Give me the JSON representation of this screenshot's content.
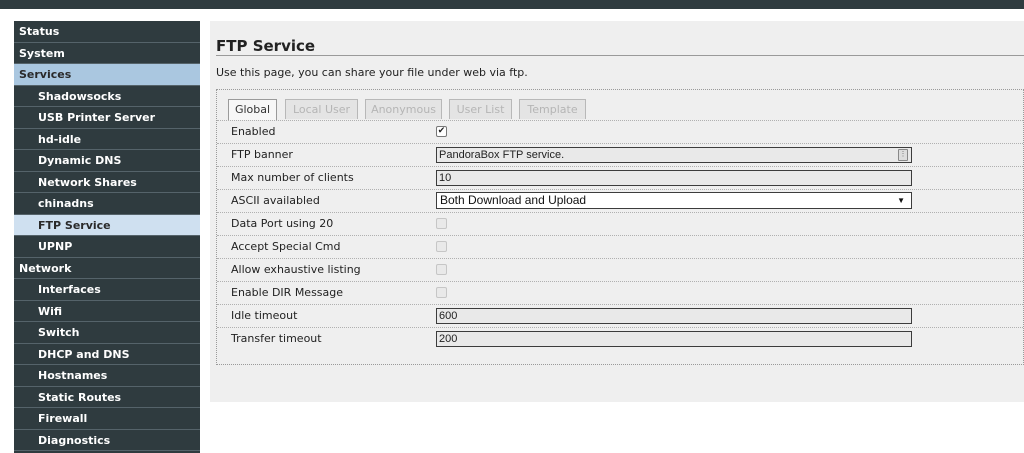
{
  "sidebar": {
    "items": [
      {
        "label": "Status",
        "level": "section",
        "state": ""
      },
      {
        "label": "System",
        "level": "section",
        "state": ""
      },
      {
        "label": "Services",
        "level": "section",
        "state": "active"
      },
      {
        "label": "Shadowsocks",
        "level": "sub",
        "state": ""
      },
      {
        "label": "USB Printer Server",
        "level": "sub",
        "state": ""
      },
      {
        "label": "hd-idle",
        "level": "sub",
        "state": ""
      },
      {
        "label": "Dynamic DNS",
        "level": "sub",
        "state": ""
      },
      {
        "label": "Network Shares",
        "level": "sub",
        "state": ""
      },
      {
        "label": "chinadns",
        "level": "sub",
        "state": ""
      },
      {
        "label": "FTP Service",
        "level": "sub",
        "state": "active"
      },
      {
        "label": "UPNP",
        "level": "sub",
        "state": ""
      },
      {
        "label": "Network",
        "level": "section",
        "state": ""
      },
      {
        "label": "Interfaces",
        "level": "sub",
        "state": ""
      },
      {
        "label": "Wifi",
        "level": "sub",
        "state": ""
      },
      {
        "label": "Switch",
        "level": "sub",
        "state": ""
      },
      {
        "label": "DHCP and DNS",
        "level": "sub",
        "state": ""
      },
      {
        "label": "Hostnames",
        "level": "sub",
        "state": ""
      },
      {
        "label": "Static Routes",
        "level": "sub",
        "state": ""
      },
      {
        "label": "Firewall",
        "level": "sub",
        "state": ""
      },
      {
        "label": "Diagnostics",
        "level": "sub",
        "state": ""
      }
    ]
  },
  "page": {
    "title": "FTP Service",
    "description": "Use this page, you can share your file under web via ftp."
  },
  "tabs": [
    {
      "label": "Global",
      "active": true
    },
    {
      "label": "Local User",
      "active": false
    },
    {
      "label": "Anonymous",
      "active": false
    },
    {
      "label": "User List",
      "active": false
    },
    {
      "label": "Template",
      "active": false
    }
  ],
  "form": {
    "enabled": {
      "label": "Enabled",
      "checked": true
    },
    "ftp_banner": {
      "label": "FTP banner",
      "value": "PandoraBox FTP service."
    },
    "max_clients": {
      "label": "Max number of clients",
      "value": "10"
    },
    "ascii": {
      "label": "ASCII availabled",
      "value": "Both Download and Upload"
    },
    "data_port": {
      "label": "Data Port using 20",
      "checked": false
    },
    "special_cmd": {
      "label": "Accept Special Cmd",
      "checked": false
    },
    "exhaustive_listing": {
      "label": "Allow exhaustive listing",
      "checked": false
    },
    "dir_message": {
      "label": "Enable DIR Message",
      "checked": false
    },
    "idle_timeout": {
      "label": "Idle timeout",
      "value": "600"
    },
    "transfer_timeout": {
      "label": "Transfer timeout",
      "value": "200"
    }
  },
  "icons": {
    "checkmark": "check-icon",
    "dropdown": "chevron-down-icon",
    "field_assist": "field-assist-icon"
  },
  "colors": {
    "sidebar_bg": "#2f3b3f",
    "active_section": "#aac7e0",
    "active_item": "#cfe0f0",
    "content_bg": "#efefef"
  }
}
